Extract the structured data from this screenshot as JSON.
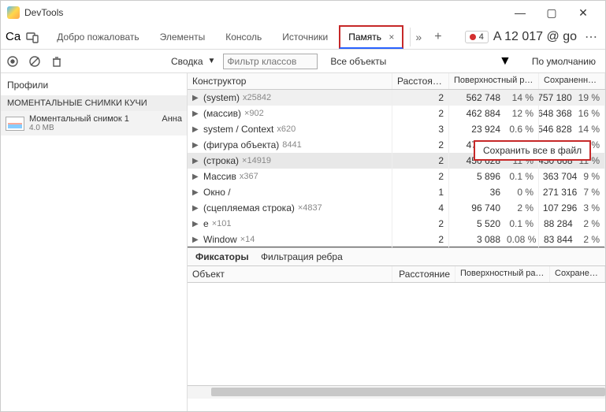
{
  "window": {
    "title": "DevTools"
  },
  "tabs": {
    "leftmode": "Ca",
    "items": [
      "Добро пожаловать",
      "Элементы",
      "Консоль",
      "Источники"
    ],
    "active": {
      "label": "Память",
      "close": "×"
    }
  },
  "topRight": {
    "rec_count": "4",
    "bigtext": "A 12 017 @ go"
  },
  "toolbar": {
    "summary": "Сводка",
    "filter_placeholder": "Фильтр классов",
    "allobjects": "Все объекты",
    "sort": "По умолчанию"
  },
  "sidebar": {
    "profiles": "Профили",
    "category": "МОМЕНТАЛЬНЫЕ СНИМКИ КУЧИ",
    "snapshot": {
      "name": "Моментальный снимок 1",
      "user": "Анна",
      "size": "4.0 MB"
    }
  },
  "table": {
    "cols": {
      "constructor": "Конструктор",
      "distance": "Расстояние",
      "shallow": "Поверхностный размер",
      "retained": "Сохраненный размер"
    },
    "contextmenu": "Сохранить все в файл",
    "rows": [
      {
        "name": "(system)",
        "count": "x25842",
        "dist": "2",
        "sh": "562 748",
        "shp": "14 %",
        "ret": "757 180",
        "retp": "19 %",
        "hl": true
      },
      {
        "name": "(массив)",
        "count": "×902",
        "dist": "2",
        "sh": "462 884",
        "shp": "12 %",
        "ret": "648 368",
        "retp": "16 %"
      },
      {
        "name": "system / Context",
        "count": "x620",
        "dist": "3",
        "sh": "23 924",
        "shp": "0.6 %",
        "ret": "546 828",
        "retp": "14 %"
      },
      {
        "name": "(фигура объекта)",
        "count": "8441",
        "dist": "2",
        "sh": "476 020",
        "shp": "12 %",
        "ret": "484 648",
        "retp": "12 %"
      },
      {
        "name": "(строка)",
        "count": "×14919",
        "dist": "2",
        "sh": "450 628",
        "shp": "11 %",
        "ret": "450 668",
        "retp": "11 %",
        "sel": true
      },
      {
        "name": "Массив",
        "count": "x367",
        "dist": "2",
        "sh": "5 896",
        "shp": "0.1 %",
        "ret": "363 704",
        "retp": "9 %"
      },
      {
        "name": "Окно",
        "count": "",
        "extra": "/",
        "dist": "1",
        "sh": "36",
        "shp": "0 %",
        "ret": "271 316",
        "retp": "7 %"
      },
      {
        "name": "(сцепляемая строка)",
        "count": "×4837",
        "dist": "4",
        "sh": "96 740",
        "shp": "2 %",
        "ret": "107 296",
        "retp": "3 %"
      },
      {
        "name": "e",
        "count": "×101",
        "dist": "2",
        "sh": "5 520",
        "shp": "0.1 %",
        "ret": "88 284",
        "retp": "2 %"
      },
      {
        "name": "Window",
        "count": "×14",
        "dist": "2",
        "sh": "3 088",
        "shp": "0.08 %",
        "ret": "83 844",
        "retp": "2 %"
      }
    ]
  },
  "retainers": {
    "fixators": "Фиксаторы",
    "filter": "Фильтрация ребра",
    "obj": "Объект",
    "dist": "Расстояние",
    "sh": "Поверхностный размер",
    "ret": "Сохраненный размер"
  }
}
